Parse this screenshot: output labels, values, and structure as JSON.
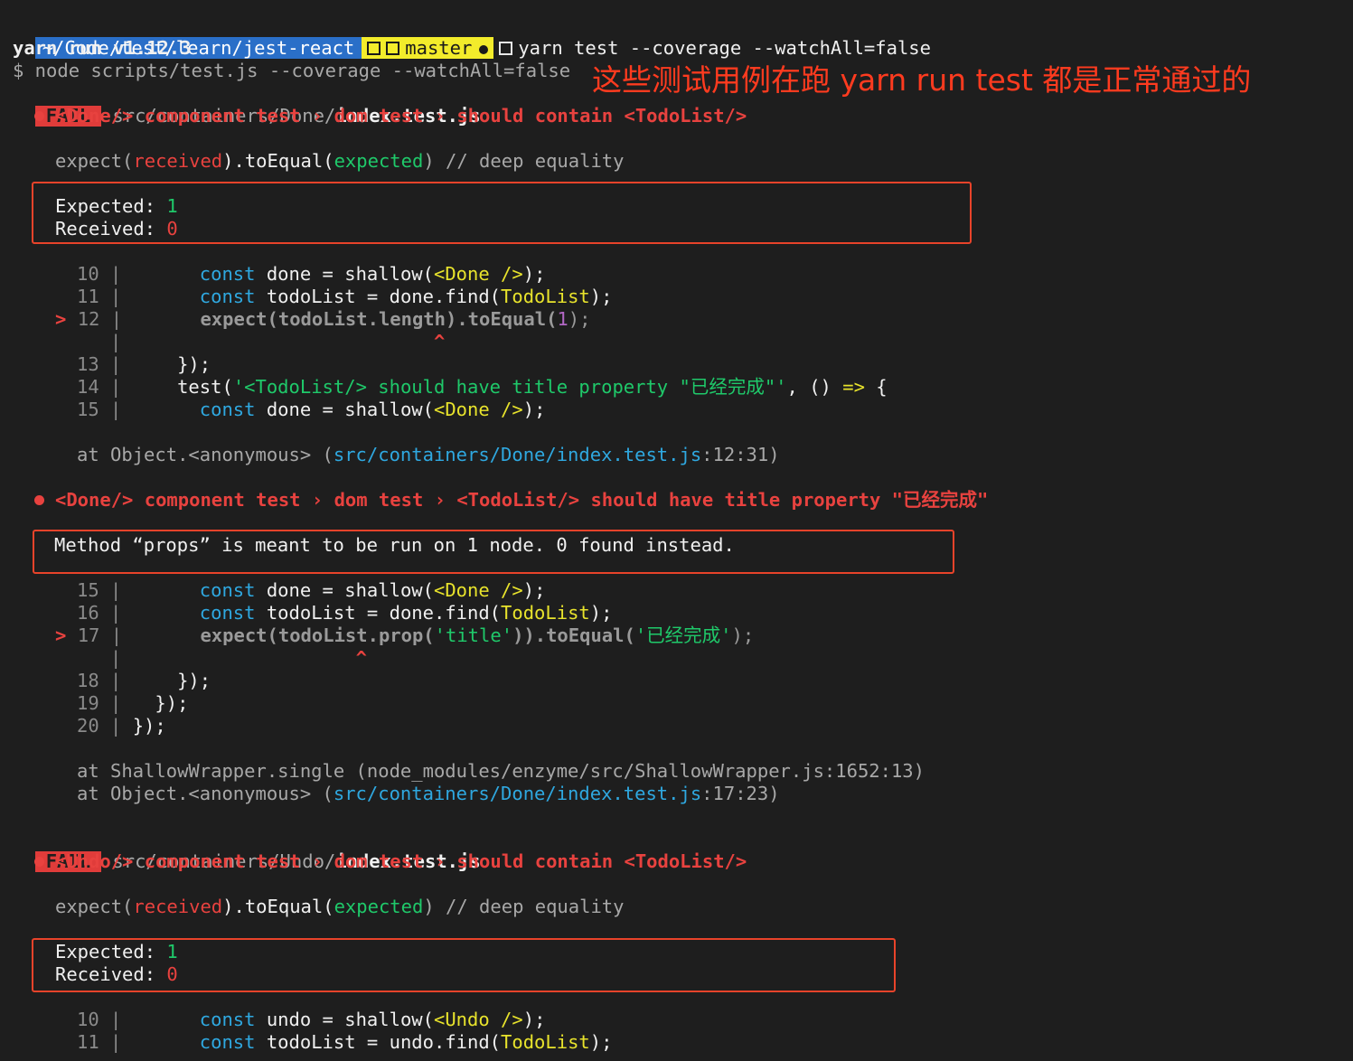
{
  "prompt": {
    "path": "~/Code/test/learn/jest-react",
    "branch": "master",
    "command": "yarn test --coverage --watchAll=false"
  },
  "header": {
    "yarn_version": "yarn run v1.12.3",
    "node_cmd": "$ node scripts/test.js --coverage --watchAll=false"
  },
  "annotation": "这些测试用例在跑 yarn run test 都是正常通过的",
  "fail_badge": "FAIL",
  "suite1": {
    "path_prefix": "src/containers/Done/",
    "file": "index.test.js",
    "test1": {
      "parts": [
        "<Done/> component test",
        "dom test",
        "should contain <TodoList/>"
      ],
      "sep": "›",
      "expect_line": {
        "a": "expect(",
        "received": "received",
        "b": ").toEqual(",
        "expected": "expected",
        "c": ")",
        "comment": " // deep equality"
      },
      "expected_label": "Expected: ",
      "expected_val": "1",
      "received_label": "Received: ",
      "received_val": "0",
      "code": {
        "l10": "10",
        "l11": "11",
        "l12": "12",
        "l13": "13",
        "l14": "14",
        "l15": "15",
        "pipe": "|",
        "marker": ">",
        "caret": "^",
        "c10_kw": "const",
        "c10_a": " done = shallow(",
        "c10_comp": "<Done />",
        "c10_b": ");",
        "c11_kw": "const",
        "c11_a": " todoList = done.find(",
        "c11_comp": "TodoList",
        "c11_b": ");",
        "c12_a": "expect(todoList.length).toEqual(",
        "c12_num": "1",
        "c12_b": ");",
        "c13": "});",
        "c14_a": "test(",
        "c14_str": "'<TodoList/> should have title property \"已经完成\"'",
        "c14_b": ", () ",
        "c14_arrow": "=>",
        "c14_c": " {",
        "c15_kw": "const",
        "c15_a": " done = shallow(",
        "c15_comp": "<Done />",
        "c15_b": ");"
      },
      "at_prefix": "at Object.<anonymous> (",
      "at_path": "src/containers/Done/index.test.js",
      "at_suffix": ":12:31)"
    },
    "test2": {
      "parts": [
        "<Done/> component test",
        "dom test",
        "<TodoList/> should have title property \"已经完成\""
      ],
      "sep": "›",
      "message": "Method “props” is meant to be run on 1 node. 0 found instead.",
      "code": {
        "l15": "15",
        "l16": "16",
        "l17": "17",
        "l18": "18",
        "l19": "19",
        "l20": "20",
        "pipe": "|",
        "marker": ">",
        "caret": "^",
        "c15_kw": "const",
        "c15_a": " done = shallow(",
        "c15_comp": "<Done />",
        "c15_b": ");",
        "c16_kw": "const",
        "c16_a": " todoList = done.find(",
        "c16_comp": "TodoList",
        "c16_b": ");",
        "c17_a": "expect(todoList.prop(",
        "c17_str1": "'title'",
        "c17_b": ")).toEqual(",
        "c17_str2": "'已经完成'",
        "c17_c": ");",
        "c18": "});",
        "c19": "});",
        "c20": "});"
      },
      "at1": "at ShallowWrapper.single (node_modules/enzyme/src/ShallowWrapper.js:1652:13)",
      "at_prefix": "at Object.<anonymous> (",
      "at_path": "src/containers/Done/index.test.js",
      "at_suffix": ":17:23)"
    }
  },
  "suite2": {
    "path_prefix": "src/containers/Undo/",
    "file": "index.test.js",
    "test1": {
      "parts": [
        "<Undo/> component test",
        "dom test",
        "should contain <TodoList/>"
      ],
      "sep": "›",
      "expect_line": {
        "a": "expect(",
        "received": "received",
        "b": ").toEqual(",
        "expected": "expected",
        "c": ")",
        "comment": " // deep equality"
      },
      "expected_label": "Expected: ",
      "expected_val": "1",
      "received_label": "Received: ",
      "received_val": "0",
      "code": {
        "l10": "10",
        "l11": "11",
        "pipe": "|",
        "c10_kw": "const",
        "c10_a": " undo = shallow(",
        "c10_comp": "<Undo />",
        "c10_b": ");",
        "c11_kw": "const",
        "c11_a": " todoList = undo.find(",
        "c11_comp": "TodoList",
        "c11_b": ");"
      }
    }
  }
}
